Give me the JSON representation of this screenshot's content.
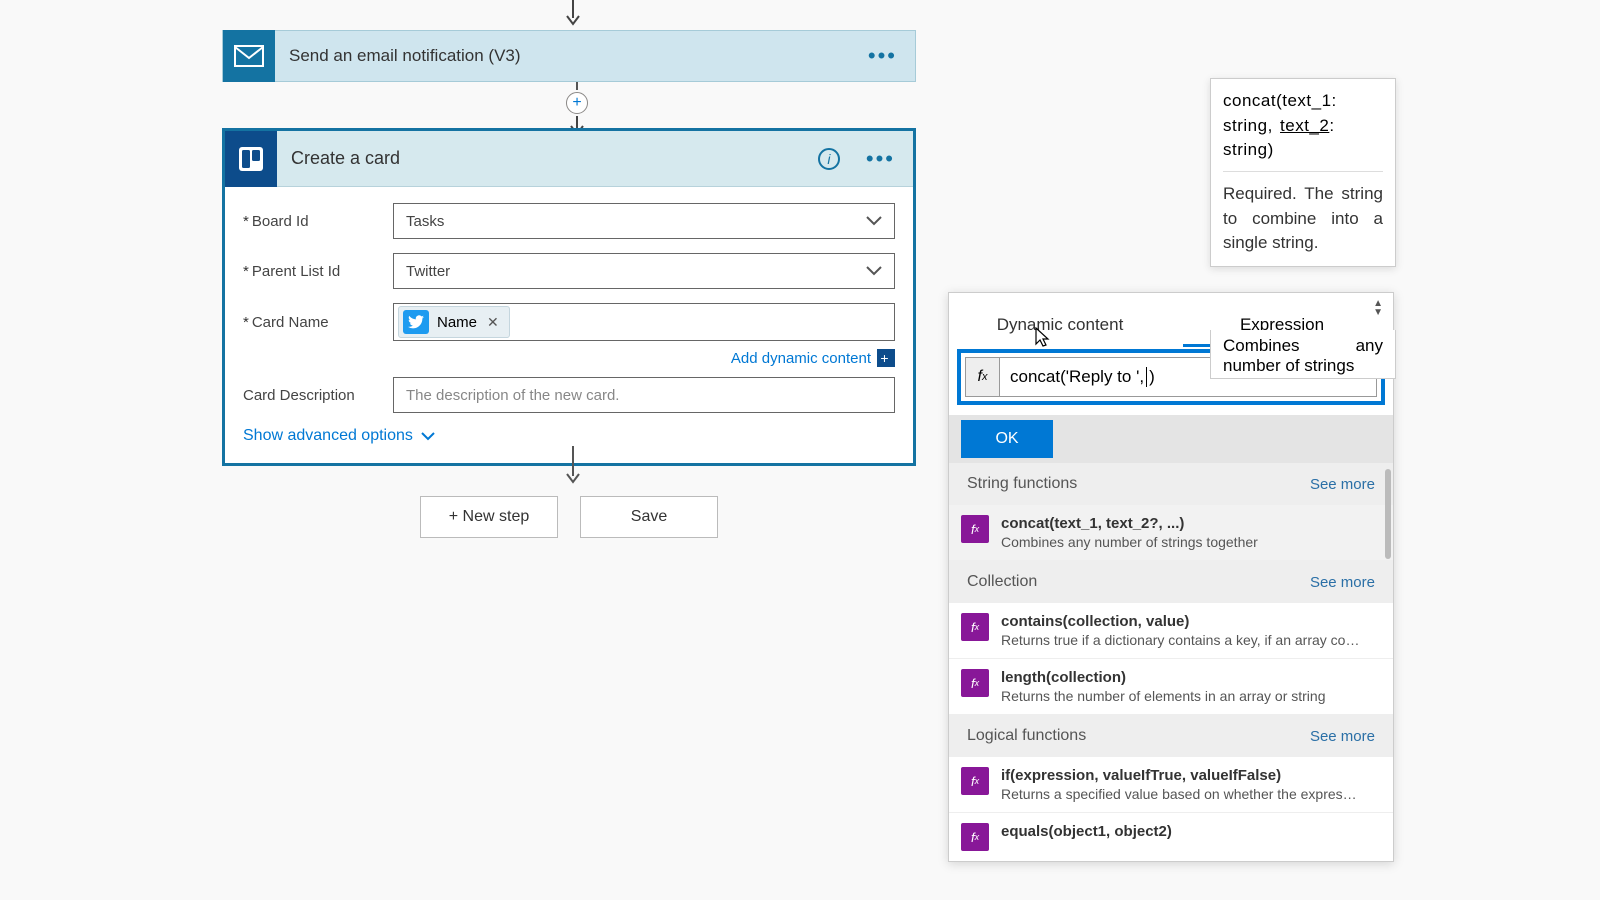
{
  "flow": {
    "email_action_title": "Send an email notification (V3)",
    "trello": {
      "title": "Create a card",
      "board_label": "Board Id",
      "board_value": "Tasks",
      "parent_list_label": "Parent List Id",
      "parent_list_value": "Twitter",
      "card_name_label": "Card Name",
      "card_name_token": "Name",
      "card_desc_label": "Card Description",
      "card_desc_placeholder": "The description of the new card.",
      "add_dyn": "Add dynamic content",
      "show_adv": "Show advanced options"
    }
  },
  "buttons": {
    "new_step": "+ New step",
    "save": "Save"
  },
  "expr_panel": {
    "tab_dynamic": "Dynamic content",
    "tab_expression": "Expression",
    "expression_prefix": "concat('Reply to ', ",
    "expression_suffix": ")",
    "ok": "OK",
    "sections": {
      "string": "String functions",
      "collection": "Collection",
      "logical": "Logical functions",
      "see_more": "See more"
    },
    "fns": {
      "concat_sig": "concat(text_1, text_2?, ...)",
      "concat_desc": "Combines any number of strings together",
      "contains_sig": "contains(collection, value)",
      "contains_desc": "Returns true if a dictionary contains a key, if an array cont...",
      "length_sig": "length(collection)",
      "length_desc": "Returns the number of elements in an array or string",
      "if_sig": "if(expression, valueIfTrue, valueIfFalse)",
      "if_desc": "Returns a specified value based on whether the expressio...",
      "equals_sig": "equals(object1, object2)"
    }
  },
  "tooltip": {
    "sig_line1": "concat(text_1:",
    "sig_line2a": "string, ",
    "sig_line2b": "text_2",
    "sig_line2c": ":",
    "sig_line3": "string)",
    "req": "Required. The string to combine into a single string.",
    "combines": "Combines any number of strings"
  },
  "fx_label": "fx"
}
